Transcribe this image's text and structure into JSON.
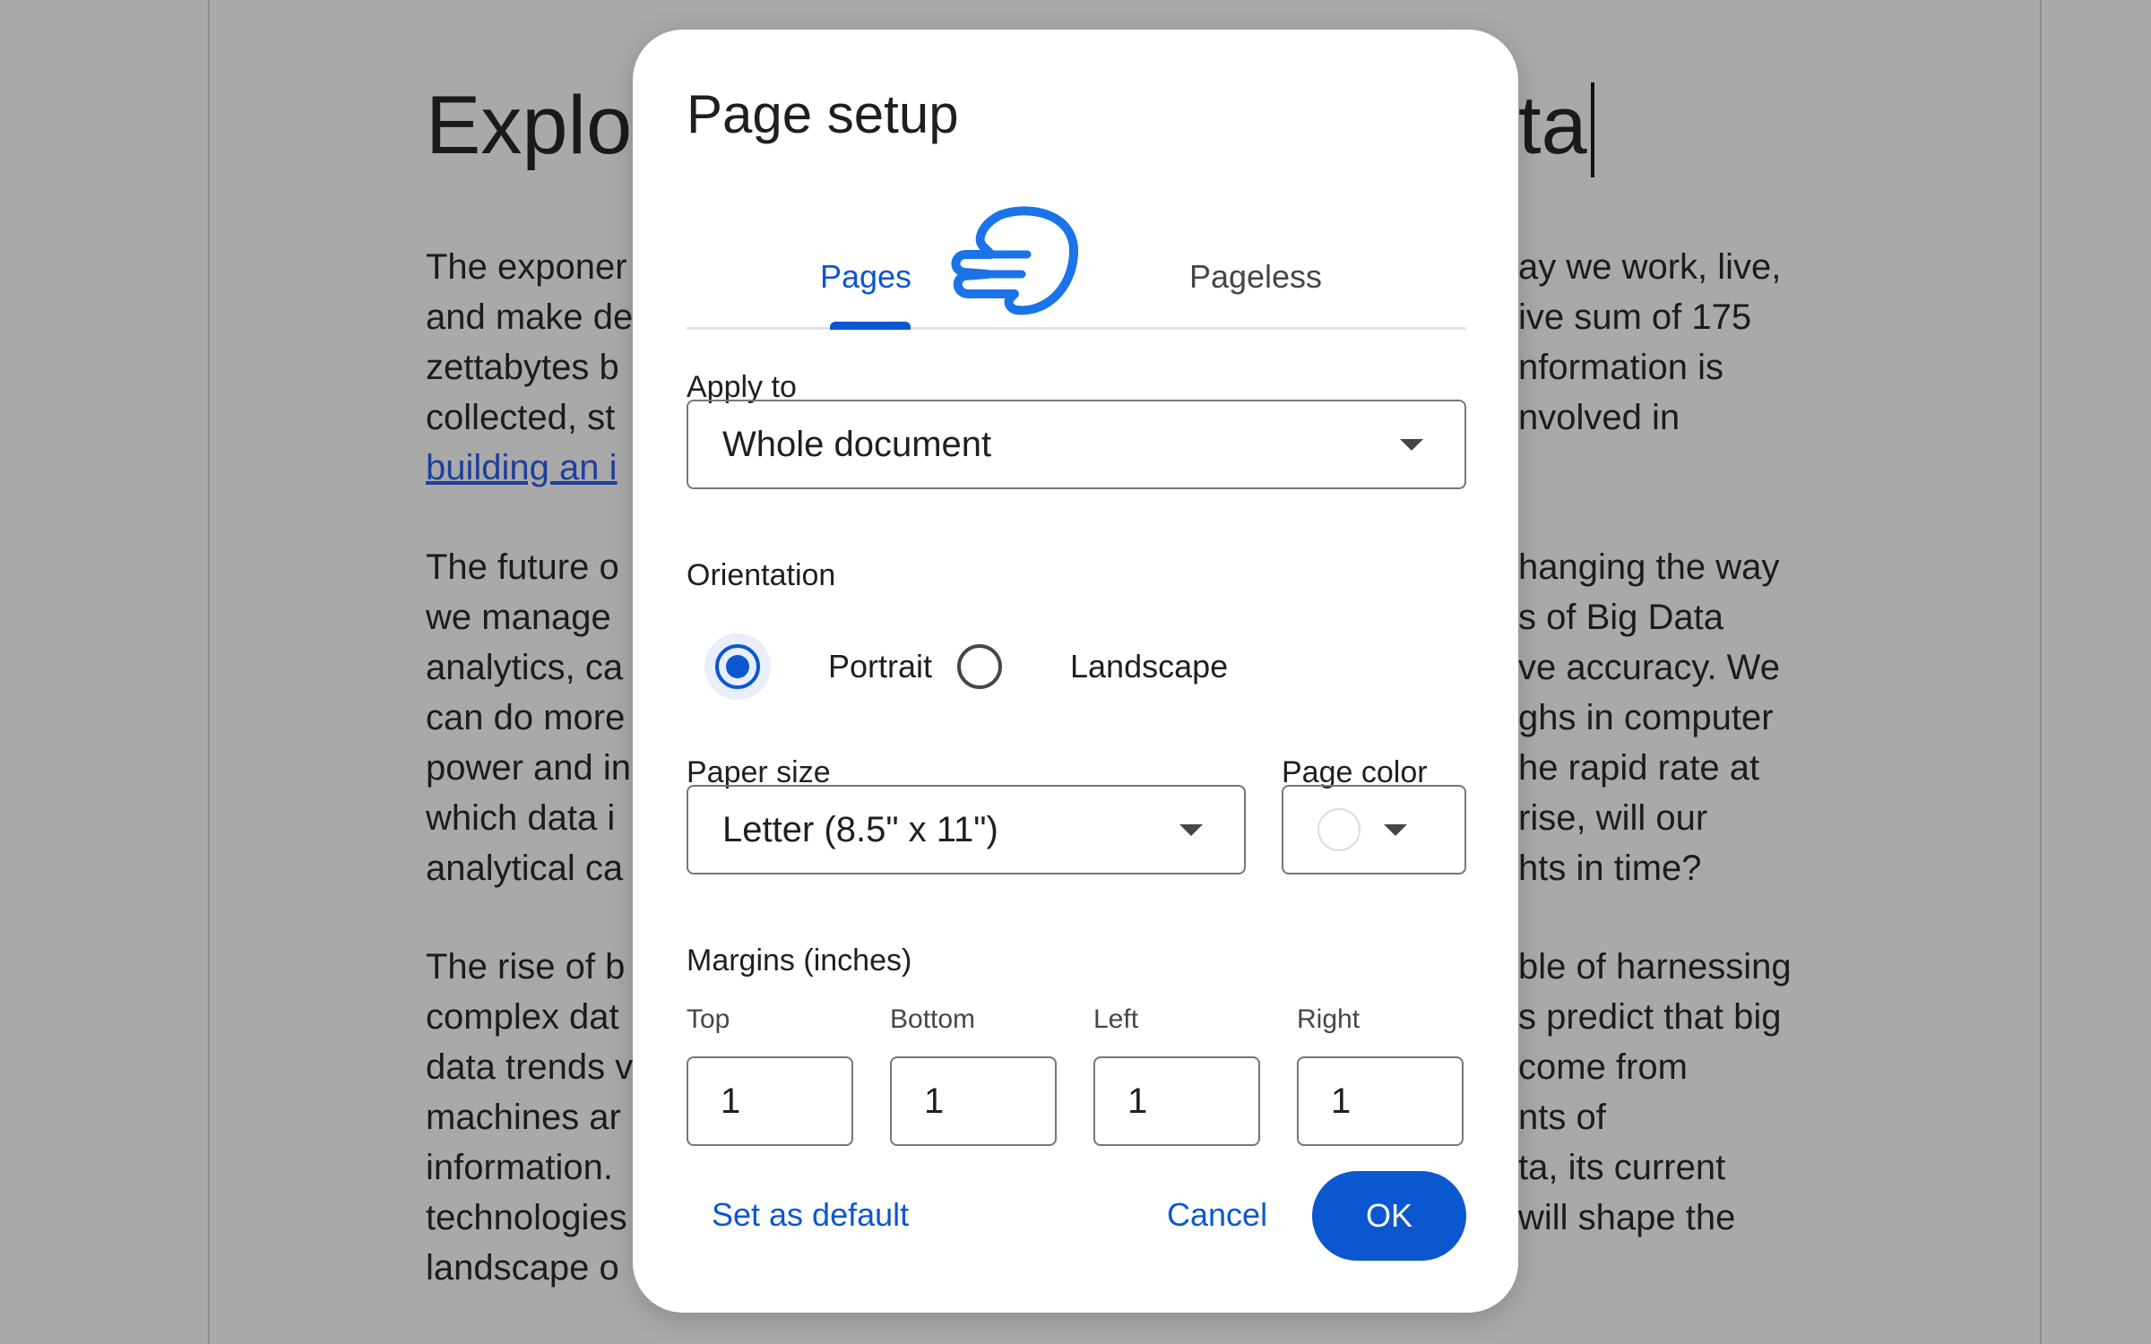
{
  "document": {
    "title_left": "Explo",
    "title_right": "ta",
    "lines": [
      {
        "left": "The exponer",
        "right": "ay we work, live,"
      },
      {
        "left": "and make de",
        "right": "ive sum of 175"
      },
      {
        "left": "zettabytes b",
        "right": "nformation is"
      },
      {
        "left": "collected, st",
        "right": "nvolved in"
      },
      {
        "left": "building an i",
        "right": ""
      },
      {
        "left": "The future o",
        "right": "hanging the way"
      },
      {
        "left": "we manage",
        "right": "s of Big Data"
      },
      {
        "left": "analytics, ca",
        "right": "ve accuracy. We"
      },
      {
        "left": "can do more",
        "right": "ghs in computer"
      },
      {
        "left": "power and in",
        "right": "he rapid rate at"
      },
      {
        "left": "which data i",
        "right": "rise, will our"
      },
      {
        "left": "analytical ca",
        "right": "hts in time?"
      },
      {
        "left": "The rise of b",
        "right": "ble of harnessing"
      },
      {
        "left": "complex dat",
        "right": "s predict that big"
      },
      {
        "left": "data trends v",
        "right": "come from"
      },
      {
        "left": "machines ar",
        "right": "nts of"
      },
      {
        "left": "information.",
        "right": "ta, its current"
      },
      {
        "left": "technologies",
        "right": "will shape the"
      },
      {
        "left": "landscape o",
        "right": ""
      }
    ]
  },
  "dialog": {
    "title": "Page setup",
    "tabs": [
      {
        "label": "Pages",
        "selected": true
      },
      {
        "label": "Pageless",
        "selected": false
      }
    ],
    "apply_to": {
      "label": "Apply to",
      "value": "Whole document"
    },
    "orientation": {
      "label": "Orientation",
      "options": [
        {
          "label": "Portrait",
          "selected": true
        },
        {
          "label": "Landscape",
          "selected": false
        }
      ]
    },
    "paper_size": {
      "label": "Paper size",
      "value": "Letter (8.5\" x 11\")"
    },
    "page_color": {
      "label": "Page color",
      "value": "#ffffff"
    },
    "margins": {
      "label": "Margins (inches)",
      "fields": [
        {
          "label": "Top",
          "value": "1"
        },
        {
          "label": "Bottom",
          "value": "1"
        },
        {
          "label": "Left",
          "value": "1"
        },
        {
          "label": "Right",
          "value": "1"
        }
      ]
    },
    "buttons": {
      "set_default": "Set as default",
      "cancel": "Cancel",
      "ok": "OK"
    }
  },
  "icons": {
    "cursor": "hand-pointer-icon",
    "dropdown": "chevron-down-icon"
  },
  "colors": {
    "accent": "#0b57d0",
    "overlay": "#a9a9a9",
    "dialog_bg": "#ffffff",
    "link": "#1f3f9c"
  }
}
